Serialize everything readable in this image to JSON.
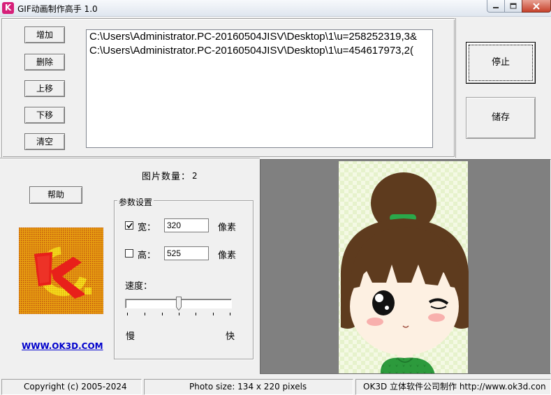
{
  "window": {
    "title": "GIF动画制作高手 1.0",
    "icon_letter": "K",
    "controls": [
      "minimize-icon",
      "maximize-icon",
      "close-icon"
    ]
  },
  "file_buttons": {
    "add": "增加",
    "delete": "删除",
    "move_up": "上移",
    "move_down": "下移",
    "clear": "清空"
  },
  "file_list": [
    "C:\\Users\\Administrator.PC-20160504JISV\\Desktop\\1\\u=258252319,3&",
    "C:\\Users\\Administrator.PC-20160504JISV\\Desktop\\1\\u=454617973,2("
  ],
  "actions": {
    "stop": "停止",
    "save": "储存"
  },
  "image_count": {
    "label": "图片数量：",
    "value": "2"
  },
  "help_button": "帮助",
  "logo": {
    "letter": "K",
    "link_text": "WWW.OK3D.COM"
  },
  "params": {
    "group_title": "参数设置",
    "width": {
      "checked": true,
      "label": "宽：",
      "value": "320",
      "unit": "像素"
    },
    "height": {
      "checked": false,
      "label": "高：",
      "value": "525",
      "unit": "像素"
    },
    "speed_label": "速度：",
    "speed_min_label": "慢",
    "speed_max_label": "快",
    "speed_level": 0.5
  },
  "status": {
    "copyright": "Copyright (c) 2005-2024",
    "photo_size": "Photo size:  134 x 220 pixels",
    "company": "OK3D 立体软件公司制作 http://www.ok3d.con"
  },
  "colors": {
    "brand_pink": "#d6207a",
    "link_blue": "#0000cc",
    "preview_bg": "#808080"
  }
}
